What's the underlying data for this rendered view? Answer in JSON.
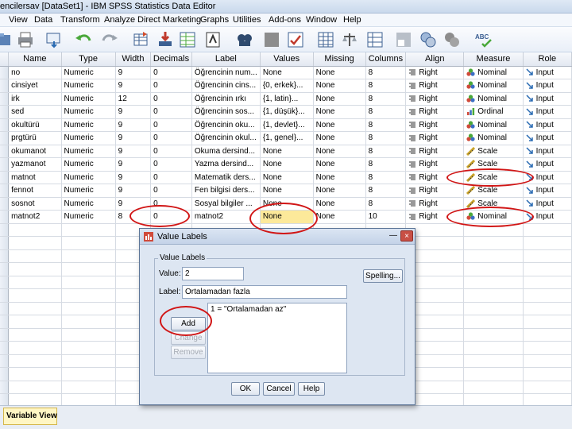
{
  "window": {
    "title": "encilersav [DataSet1] - IBM SPSS Statistics Data Editor"
  },
  "menu": [
    "View",
    "Data",
    "Transform",
    "Analyze",
    "Direct Marketing",
    "Graphs",
    "Utilities",
    "Add-ons",
    "Window",
    "Help"
  ],
  "toolbar": {
    "icons": [
      "open-icon",
      "print-icon",
      "recall-dialog-icon",
      "undo-icon",
      "redo-icon",
      "goto-case-icon",
      "goto-variable-icon",
      "variables-icon",
      "find-icon",
      "insert-cases-icon",
      "insert-variable-icon",
      "split-file-icon",
      "weight-cases-icon",
      "select-cases-icon",
      "value-labels-icon",
      "use-sets-icon",
      "show-all-variables-icon",
      "spelling-icon"
    ],
    "spell_badge": "ABC"
  },
  "grid": {
    "columns": [
      "Name",
      "Type",
      "Width",
      "Decimals",
      "Label",
      "Values",
      "Missing",
      "Columns",
      "Align",
      "Measure",
      "Role"
    ],
    "rows": [
      {
        "name": "no",
        "type": "Numeric",
        "width": "9",
        "decimals": "0",
        "label": "Öğrencinin num...",
        "values": "None",
        "missing": "None",
        "columns": "8",
        "align": "Right",
        "measure": "Nominal",
        "role": "Input"
      },
      {
        "name": "cinsiyet",
        "type": "Numeric",
        "width": "9",
        "decimals": "0",
        "label": "Öğrencinin cins...",
        "values": "{0, erkek}...",
        "missing": "None",
        "columns": "8",
        "align": "Right",
        "measure": "Nominal",
        "role": "Input"
      },
      {
        "name": "irk",
        "type": "Numeric",
        "width": "12",
        "decimals": "0",
        "label": "Öğrencinin ırkı",
        "values": "{1, latin}...",
        "missing": "None",
        "columns": "8",
        "align": "Right",
        "measure": "Nominal",
        "role": "Input"
      },
      {
        "name": "sed",
        "type": "Numeric",
        "width": "9",
        "decimals": "0",
        "label": "Öğrencinin sos...",
        "values": "{1, düşük}...",
        "missing": "None",
        "columns": "8",
        "align": "Right",
        "measure": "Ordinal",
        "role": "Input"
      },
      {
        "name": "okultürü",
        "type": "Numeric",
        "width": "9",
        "decimals": "0",
        "label": "Öğrencinin oku...",
        "values": "{1, devlet}...",
        "missing": "None",
        "columns": "8",
        "align": "Right",
        "measure": "Nominal",
        "role": "Input"
      },
      {
        "name": "prgtürü",
        "type": "Numeric",
        "width": "9",
        "decimals": "0",
        "label": "Öğrencinin okul...",
        "values": "{1, genel}...",
        "missing": "None",
        "columns": "8",
        "align": "Right",
        "measure": "Nominal",
        "role": "Input"
      },
      {
        "name": "okumanot",
        "type": "Numeric",
        "width": "9",
        "decimals": "0",
        "label": "Okuma dersind...",
        "values": "None",
        "missing": "None",
        "columns": "8",
        "align": "Right",
        "measure": "Scale",
        "role": "Input"
      },
      {
        "name": "yazmanot",
        "type": "Numeric",
        "width": "9",
        "decimals": "0",
        "label": "Yazma dersind...",
        "values": "None",
        "missing": "None",
        "columns": "8",
        "align": "Right",
        "measure": "Scale",
        "role": "Input"
      },
      {
        "name": "matnot",
        "type": "Numeric",
        "width": "9",
        "decimals": "0",
        "label": "Matematik ders...",
        "values": "None",
        "missing": "None",
        "columns": "8",
        "align": "Right",
        "measure": "Scale",
        "role": "Input"
      },
      {
        "name": "fennot",
        "type": "Numeric",
        "width": "9",
        "decimals": "0",
        "label": "Fen bilgisi ders...",
        "values": "None",
        "missing": "None",
        "columns": "8",
        "align": "Right",
        "measure": "Scale",
        "role": "Input"
      },
      {
        "name": "sosnot",
        "type": "Numeric",
        "width": "9",
        "decimals": "0",
        "label": "Sosyal bilgiler ...",
        "values": "None",
        "missing": "None",
        "columns": "8",
        "align": "Right",
        "measure": "Scale",
        "role": "Input"
      },
      {
        "name": "matnot2",
        "type": "Numeric",
        "width": "8",
        "decimals": "0",
        "label": "matnot2",
        "values": "None",
        "missing": "None",
        "columns": "10",
        "align": "Right",
        "measure": "Nominal",
        "role": "Input"
      }
    ],
    "empty_rows": 14
  },
  "status": {
    "variable_view_tab": "Variable View"
  },
  "dialog": {
    "title": "Value Labels",
    "group_label": "Value Labels",
    "value_label": "Value:",
    "value": "2",
    "label_label": "Label:",
    "label_value": "Ortalamadan fazla",
    "list_items": [
      "1 = \"Ortalamadan az\""
    ],
    "spelling_button": "Spelling...",
    "add_button": "Add",
    "change_button": "Change",
    "remove_button": "Remove",
    "ok_button": "OK",
    "cancel_button": "Cancel",
    "help_button": "Help"
  },
  "colors": {
    "annotation_ring": "#d11616",
    "selected_cell": "#fce99a",
    "accent": "#3b5f92"
  }
}
